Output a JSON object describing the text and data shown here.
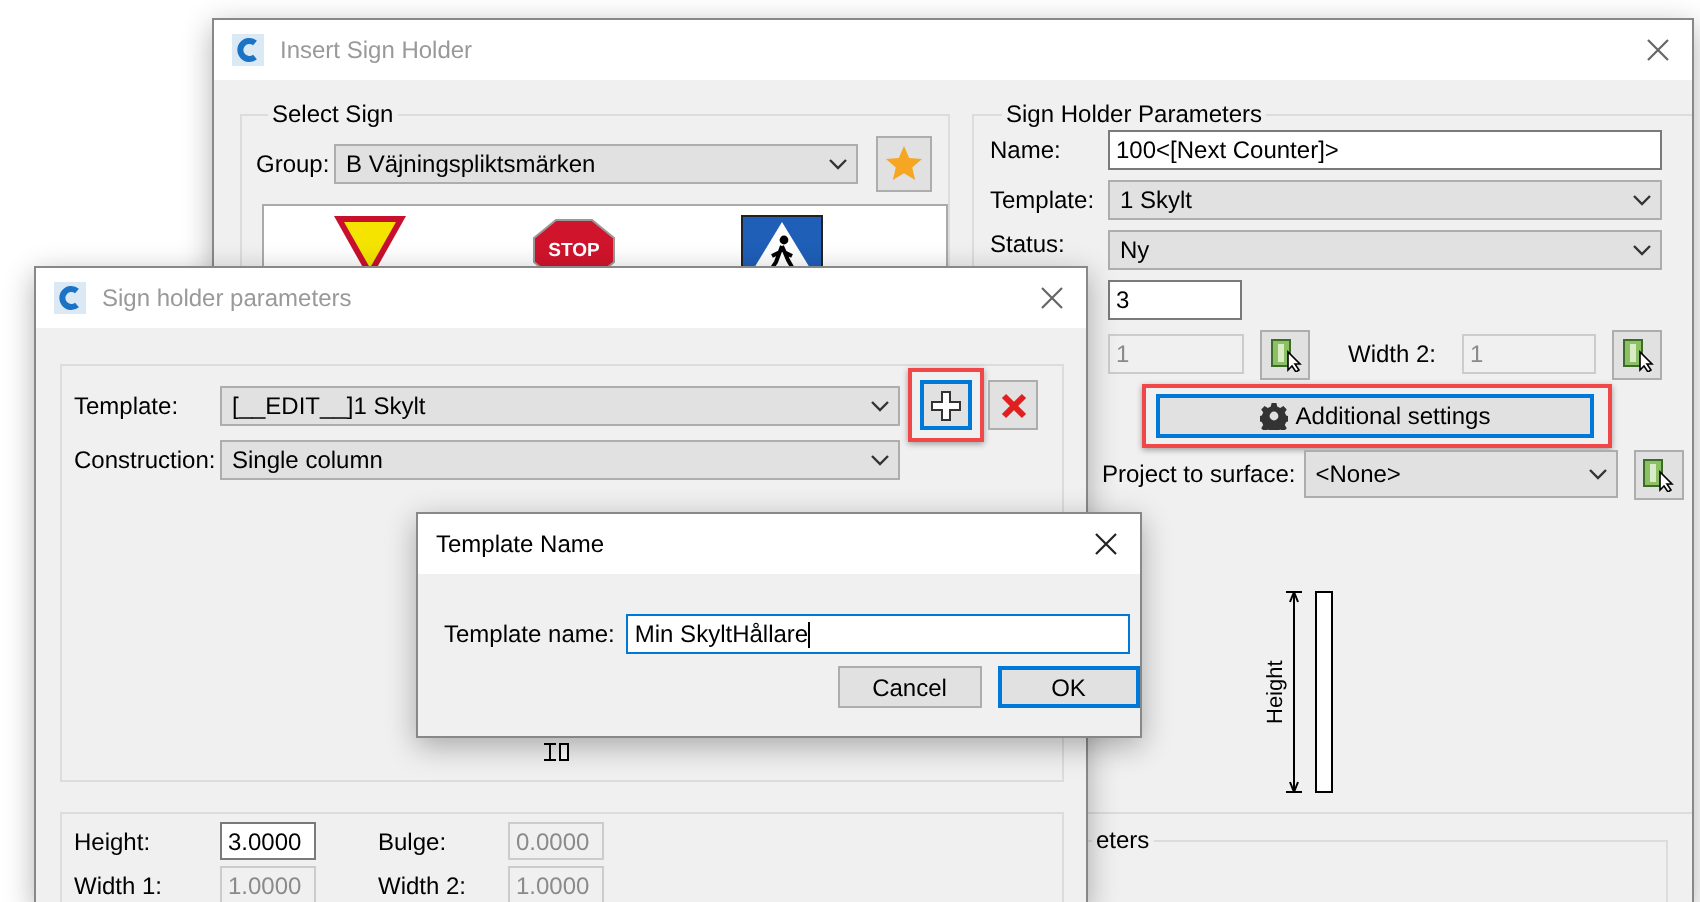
{
  "insert_sign_holder": {
    "title": "Insert Sign Holder",
    "active": false,
    "select_sign": {
      "title": "Select Sign",
      "group_label": "Group:",
      "group_value": "B Väjningspliktsmärken",
      "signs": [
        {
          "kind": "yield"
        },
        {
          "kind": "stop",
          "text": "STOP"
        },
        {
          "kind": "crossing"
        }
      ]
    },
    "parameters": {
      "title": "Sign Holder Parameters",
      "name": {
        "label": "Name:",
        "value": "100<[Next Counter]>"
      },
      "template": {
        "label": "Template:",
        "value": "1 Skylt"
      },
      "status": {
        "label": "Status:",
        "value": "Ny"
      },
      "count": {
        "value": "3"
      },
      "width_1": {
        "value": "1",
        "disabled": true
      },
      "width_2": {
        "label": "Width 2:",
        "value": "1",
        "disabled": true
      },
      "additional_settings": {
        "label": "Additional settings",
        "focused": true,
        "highlighted": true
      },
      "project_to_surface": {
        "label": "Project to surface:",
        "value": "<None>"
      },
      "diagram_label": "Height"
    },
    "group_3": {
      "title": "eters"
    }
  },
  "sign_holder_parameters": {
    "title": "Sign holder parameters",
    "active": false,
    "template": {
      "label": "Template:",
      "value": "[__EDIT__]1 Skylt"
    },
    "add_button": {
      "focused": true,
      "highlighted": true
    },
    "delete_button": {
      "highlighted": false
    },
    "construction": {
      "label": "Construction:",
      "value": "Single column"
    },
    "height": {
      "label": "Height:",
      "value": "3.0000",
      "disabled": false
    },
    "bulge": {
      "label": "Bulge:",
      "value": "0.0000",
      "disabled": true
    },
    "width_1": {
      "label": "Width 1:",
      "value": "1.0000",
      "disabled": true
    },
    "width_2": {
      "label": "Width 2:",
      "value": "1.0000",
      "disabled": true
    }
  },
  "template_name": {
    "title": "Template Name",
    "active": true,
    "label": "Template name:",
    "value": "Min SkyltHållare",
    "focused": true,
    "buttons": [
      {
        "label": "Cancel",
        "default": false
      },
      {
        "label": "OK",
        "default": true
      }
    ]
  }
}
